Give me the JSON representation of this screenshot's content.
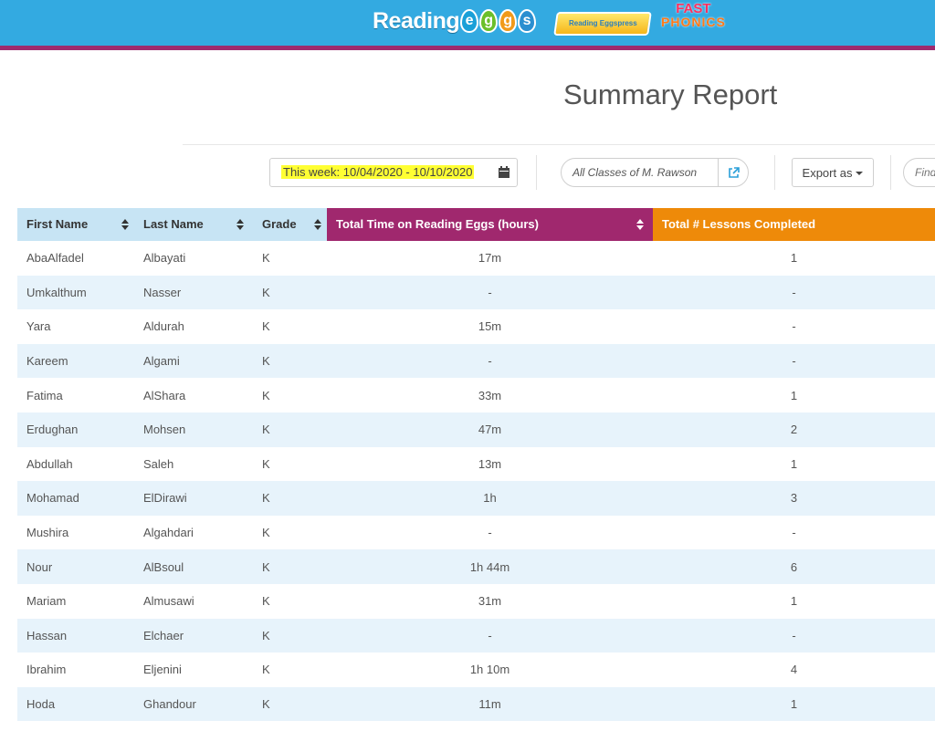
{
  "brand": {
    "logos": [
      "Reading",
      "Reading Eggspress",
      "Fast Phonics"
    ],
    "reading_eggs_word": "Reading",
    "egg_letters": [
      "e",
      "g",
      "g",
      "s"
    ],
    "eggspress_label": "Reading Eggspress",
    "fast_phonics_line1": "FAST",
    "fast_phonics_line2": "PHONICS",
    "colors": {
      "banner": "#33aae1",
      "stripe": "#9e2b6e"
    }
  },
  "page": {
    "title": "Summary Report"
  },
  "toolbar": {
    "date_range": "This week: 10/04/2020 - 10/10/2020",
    "calendar_icon": "calendar-icon",
    "class_filter": "All Classes of M. Rawson",
    "open_class_icon": "external-link-icon",
    "export_label": "Export as",
    "find_placeholder": "Find"
  },
  "table": {
    "columns": [
      {
        "label": "First Name",
        "sortable": true
      },
      {
        "label": "Last Name",
        "sortable": true
      },
      {
        "label": "Grade",
        "sortable": true
      },
      {
        "label": "Total Time on Reading Eggs (hours)",
        "sortable": true,
        "color": "#a0286e"
      },
      {
        "label": "Total # Lessons Completed",
        "sortable": false,
        "color": "#ee8a09"
      }
    ],
    "rows": [
      [
        "AbaAlfadel",
        "Albayati",
        "K",
        "17m",
        "1"
      ],
      [
        "Umkalthum",
        "Nasser",
        "K",
        "-",
        "-"
      ],
      [
        "Yara",
        "Aldurah",
        "K",
        "15m",
        "-"
      ],
      [
        "Kareem",
        "Algami",
        "K",
        "-",
        "-"
      ],
      [
        "Fatima",
        "AlShara",
        "K",
        "33m",
        "1"
      ],
      [
        "Erdughan",
        "Mohsen",
        "K",
        "47m",
        "2"
      ],
      [
        "Abdullah",
        "Saleh",
        "K",
        "13m",
        "1"
      ],
      [
        "Mohamad",
        "ElDirawi",
        "K",
        "1h",
        "3"
      ],
      [
        "Mushira",
        "Algahdari",
        "K",
        "-",
        "-"
      ],
      [
        "Nour",
        "AlBsoul",
        "K",
        "1h 44m",
        "6"
      ],
      [
        "Mariam",
        "Almusawi",
        "K",
        "31m",
        "1"
      ],
      [
        "Hassan",
        "Elchaer",
        "K",
        "-",
        "-"
      ],
      [
        "Ibrahim",
        "Eljenini",
        "K",
        "1h 10m",
        "4"
      ],
      [
        "Hoda",
        "Ghandour",
        "K",
        "11m",
        "1"
      ]
    ]
  }
}
